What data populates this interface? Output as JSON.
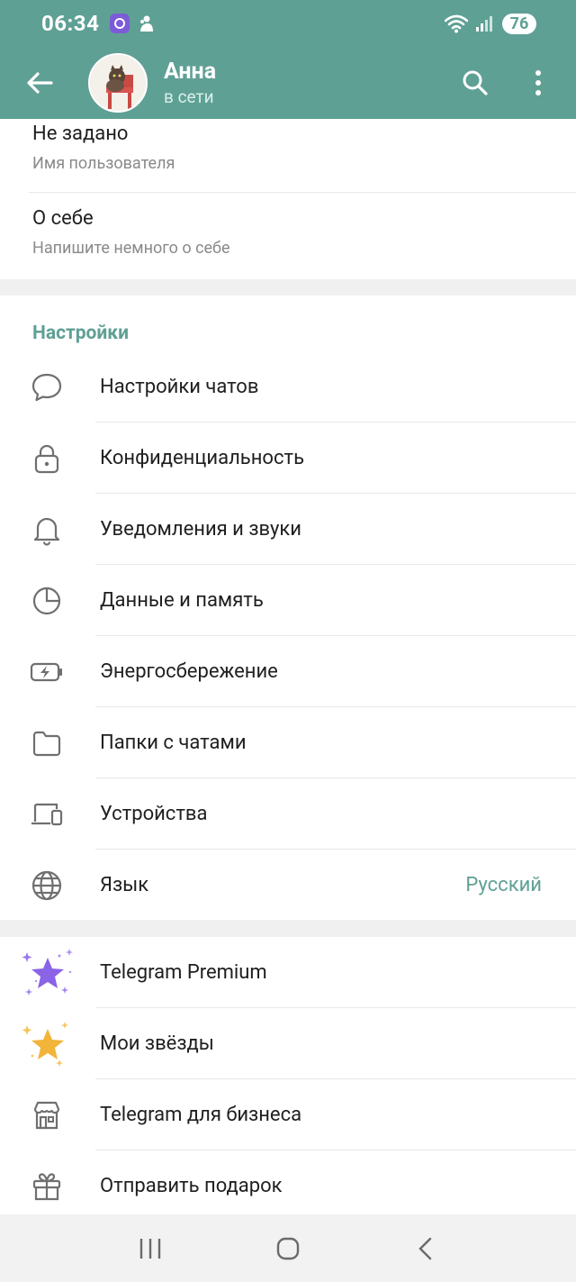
{
  "status_bar": {
    "time": "06:34",
    "battery": "76"
  },
  "header": {
    "name": "Анна",
    "status": "в сети"
  },
  "profile": {
    "username_value": "Не задано",
    "username_label": "Имя пользователя",
    "bio_value": "О себе",
    "bio_label": "Напишите немного о себе"
  },
  "settings": {
    "title": "Настройки",
    "items": [
      {
        "label": "Настройки чатов",
        "icon": "chat-bubble-icon"
      },
      {
        "label": "Конфиденциальность",
        "icon": "lock-icon"
      },
      {
        "label": "Уведомления и звуки",
        "icon": "bell-icon"
      },
      {
        "label": "Данные и память",
        "icon": "pie-chart-icon"
      },
      {
        "label": "Энергосбережение",
        "icon": "battery-bolt-icon"
      },
      {
        "label": "Папки с чатами",
        "icon": "folder-icon"
      },
      {
        "label": "Устройства",
        "icon": "devices-icon"
      },
      {
        "label": "Язык",
        "icon": "globe-icon",
        "value": "Русский"
      }
    ]
  },
  "extras": {
    "items": [
      {
        "label": "Telegram Premium",
        "icon": "premium-star-icon"
      },
      {
        "label": "Мои звёзды",
        "icon": "gold-star-icon"
      },
      {
        "label": "Telegram для бизнеса",
        "icon": "shop-icon"
      },
      {
        "label": "Отправить подарок",
        "icon": "gift-icon"
      }
    ]
  },
  "colors": {
    "accent": "#5fa095",
    "premium": "#8a63e6",
    "star": "#f2b53a"
  }
}
